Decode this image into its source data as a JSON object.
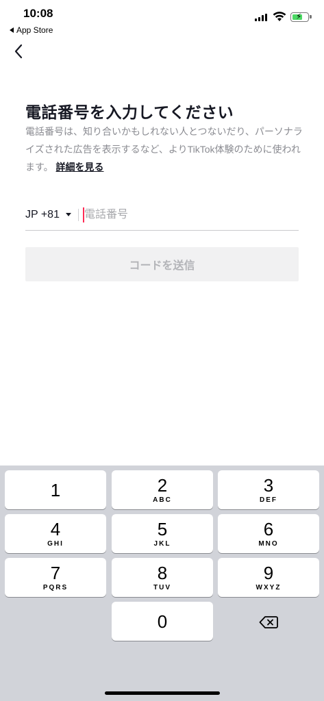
{
  "status": {
    "time": "10:08",
    "back_app": "App Store"
  },
  "page": {
    "title": "電話番号を入力してください",
    "description": "電話番号は、知り合いかもしれない人とつないだり、パーソナライズされた広告を表示するなど、よりTikTok体験のために使われます。",
    "more_link": "詳細を見る"
  },
  "phone": {
    "country_code": "JP +81",
    "placeholder": "電話番号",
    "value": ""
  },
  "send_button": "コードを送信",
  "keypad": {
    "keys": [
      {
        "num": "1",
        "letters": ""
      },
      {
        "num": "2",
        "letters": "ABC"
      },
      {
        "num": "3",
        "letters": "DEF"
      },
      {
        "num": "4",
        "letters": "GHI"
      },
      {
        "num": "5",
        "letters": "JKL"
      },
      {
        "num": "6",
        "letters": "MNO"
      },
      {
        "num": "7",
        "letters": "PQRS"
      },
      {
        "num": "8",
        "letters": "TUV"
      },
      {
        "num": "9",
        "letters": "WXYZ"
      },
      {
        "num": "0",
        "letters": ""
      }
    ]
  },
  "colors": {
    "accent_cursor": "#fe2c55",
    "text_primary": "#161823",
    "text_secondary": "#8a8b91",
    "button_disabled_bg": "#f1f1f2",
    "keypad_bg": "#d1d3d9"
  },
  "icons": {
    "nav_back": "chevron-left-icon",
    "country_caret": "caret-down-icon",
    "delete": "backspace-icon"
  }
}
